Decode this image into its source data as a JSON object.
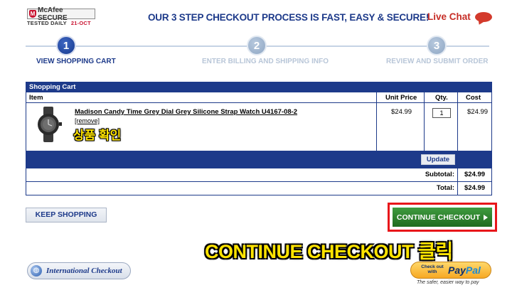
{
  "security_badge": {
    "brand": "McAfee SECURE",
    "tested": "TESTED DAILY",
    "date": "21-OCT"
  },
  "header": {
    "headline": "OUR 3 STEP CHECKOUT PROCESS IS FAST, EASY & SECURE!",
    "live_chat": "Live Chat"
  },
  "steps": [
    {
      "number": "1",
      "label": "VIEW SHOPPING CART",
      "active": true
    },
    {
      "number": "2",
      "label": "ENTER BILLING AND SHIPPING INFO",
      "active": false
    },
    {
      "number": "3",
      "label": "REVIEW AND SUBMIT ORDER",
      "active": false
    }
  ],
  "cart": {
    "title": "Shopping Cart",
    "columns": {
      "item": "Item",
      "unit_price": "Unit Price",
      "qty": "Qty.",
      "cost": "Cost"
    },
    "items": [
      {
        "name": "Madison Candy Time Grey Dial Grey Silicone Strap Watch U4167-08-2",
        "remove": "[remove]",
        "unit_price": "$24.99",
        "qty": "1",
        "cost": "$24.99"
      }
    ],
    "update_label": "Update",
    "subtotal_label": "Subtotal:",
    "subtotal": "$24.99",
    "total_label": "Total:",
    "total": "$24.99"
  },
  "annotations": {
    "product_check": "상품 확인",
    "click_continue": "CONTINUE CHECKOUT 클릭"
  },
  "actions": {
    "keep_shopping": "KEEP SHOPPING",
    "continue_checkout": "CONTINUE CHECKOUT",
    "international_checkout": "International Checkout",
    "paypal_small": "Check out with",
    "paypal_pay": "Pay",
    "paypal_pal": "Pal",
    "paypal_tagline": "The safer, easier way to pay"
  },
  "colors": {
    "brand_blue": "#1d3a8a",
    "continue_green": "#2e8b2e",
    "highlight_red": "#e8161a",
    "annotation_yellow": "#ffe300"
  }
}
